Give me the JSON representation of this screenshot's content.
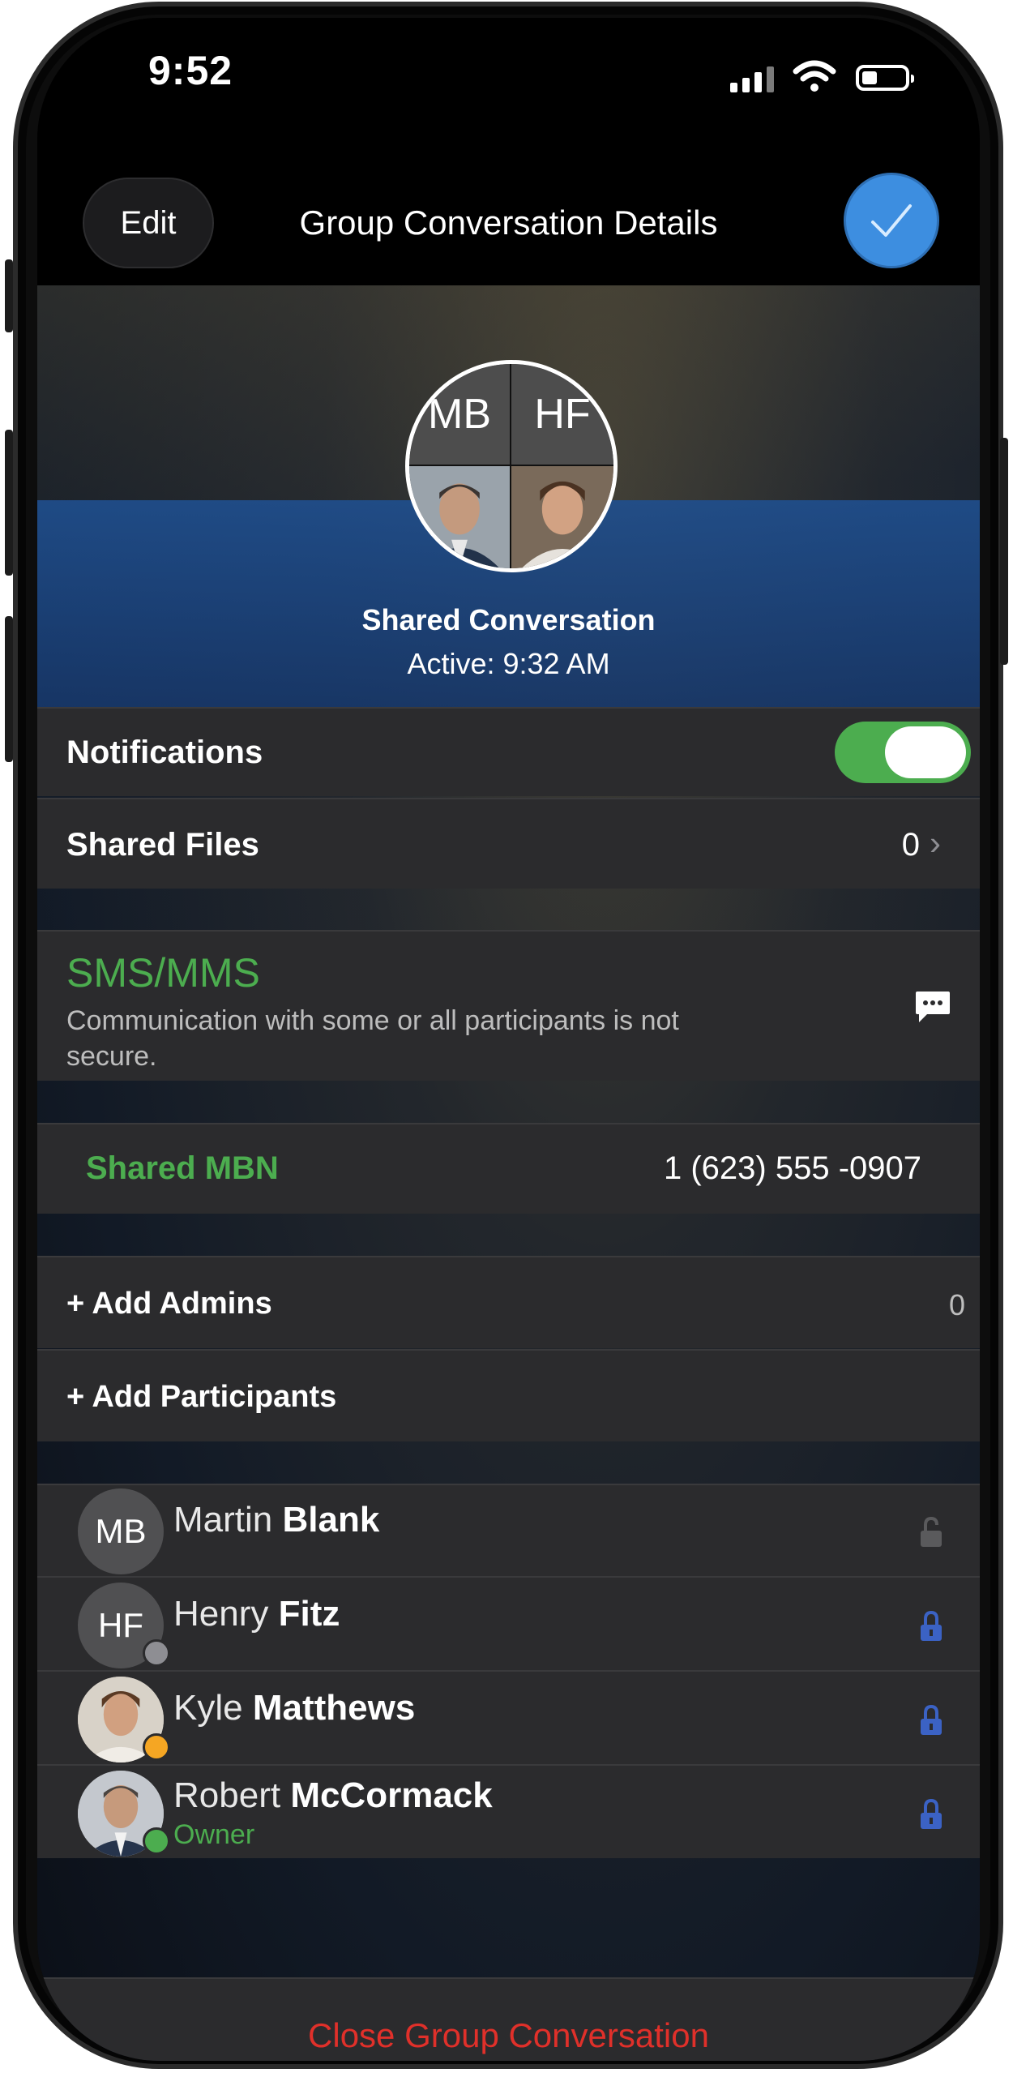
{
  "status_bar": {
    "time": "9:52",
    "icons": [
      "cellular-signal-icon",
      "wifi-icon",
      "battery-icon"
    ]
  },
  "nav": {
    "edit_label": "Edit",
    "title": "Group Conversation Details",
    "done_icon": "checkmark-icon",
    "done_color": "#3d8ee0"
  },
  "header": {
    "avatar_quadrants": [
      "MB",
      "HF"
    ],
    "name": "Shared Conversation",
    "active": "Active: 9:32 AM"
  },
  "notifications": {
    "label": "Notifications",
    "enabled": true,
    "toggle_color": "#4cad4f"
  },
  "shared_files": {
    "label": "Shared Files",
    "count": "0"
  },
  "sms": {
    "title": "SMS/MMS",
    "description": "Communication with some or all participants is not secure.",
    "icon": "message-bubble-icon"
  },
  "shared_mbn": {
    "label": "Shared MBN",
    "number": "1 (623) 555 -0907"
  },
  "admins": {
    "label": "+ Add Admins",
    "count": "0"
  },
  "participants_action": {
    "label": "+ Add Participants"
  },
  "participants": [
    {
      "initials": "MB",
      "first": "Martin",
      "last": "Blank",
      "role": "",
      "lock": "unlocked",
      "presence": "none"
    },
    {
      "initials": "HF",
      "first": "Henry",
      "last": "Fitz",
      "role": "",
      "lock": "locked",
      "presence": "offline"
    },
    {
      "initials": "",
      "first": "Kyle",
      "last": "Matthews",
      "role": "",
      "lock": "locked",
      "presence": "away"
    },
    {
      "initials": "",
      "first": "Robert",
      "last": "McCormack",
      "role": "Owner",
      "lock": "locked",
      "presence": "available"
    }
  ],
  "colors": {
    "accent_green": "#4cad4f",
    "lock_blue": "#3b62c4",
    "destructive_red": "#e0302a"
  },
  "close_label": "Close Group Conversation"
}
